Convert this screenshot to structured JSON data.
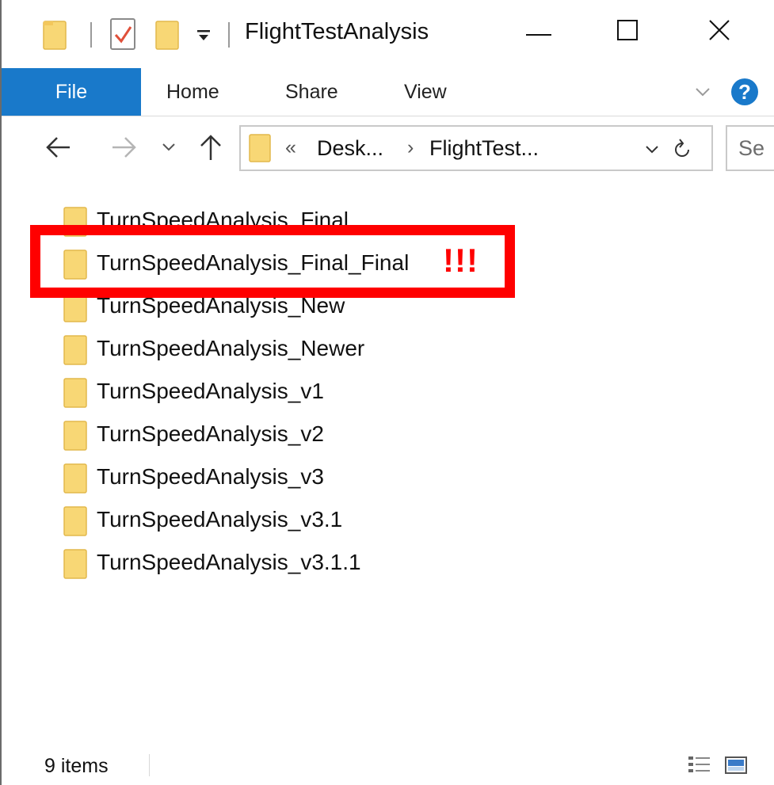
{
  "window": {
    "title": "FlightTestAnalysis"
  },
  "ribbon": {
    "tabs": [
      {
        "label": "File"
      },
      {
        "label": "Home"
      },
      {
        "label": "Share"
      },
      {
        "label": "View"
      }
    ],
    "help_label": "?"
  },
  "address_bar": {
    "overflow": "«",
    "crumbs": [
      {
        "label": "Desk..."
      },
      {
        "label": "FlightTest..."
      }
    ],
    "separator": "›",
    "search_placeholder": "Se"
  },
  "files": [
    {
      "name": "TurnSpeedAnalysis_Final"
    },
    {
      "name": "TurnSpeedAnalysis_Final_Final"
    },
    {
      "name": "TurnSpeedAnalysis_New"
    },
    {
      "name": "TurnSpeedAnalysis_Newer"
    },
    {
      "name": "TurnSpeedAnalysis_v1"
    },
    {
      "name": "TurnSpeedAnalysis_v2"
    },
    {
      "name": "TurnSpeedAnalysis_v3"
    },
    {
      "name": "TurnSpeedAnalysis_v3.1"
    },
    {
      "name": "TurnSpeedAnalysis_v3.1.1"
    }
  ],
  "annotation": {
    "text": "!!!",
    "color": "#ff0000",
    "highlighted_item": "TurnSpeedAnalysis_Final_Final"
  },
  "status_bar": {
    "item_count": "9 items"
  },
  "colors": {
    "accent": "#1979ca",
    "folder": "#f8d775"
  },
  "icons": [
    "folder-icon",
    "properties-icon",
    "dropdown-icon",
    "minimize-icon",
    "maximize-icon",
    "close-icon",
    "back-arrow-icon",
    "forward-arrow-icon",
    "recent-chevron-icon",
    "up-arrow-icon",
    "refresh-icon",
    "help-icon",
    "details-view-icon",
    "large-icons-view-icon"
  ]
}
